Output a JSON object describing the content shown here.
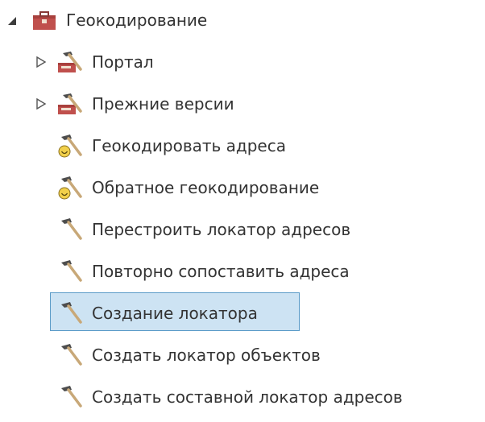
{
  "tree": {
    "root": {
      "label": "Геокодирование",
      "expanded": true,
      "icon": "toolbox-icon"
    },
    "items": [
      {
        "label": "Портал",
        "icon": "toolset-icon",
        "expandable": true
      },
      {
        "label": "Прежние версии",
        "icon": "toolset-icon",
        "expandable": true
      },
      {
        "label": "Геокодировать адреса",
        "icon": "hammer-geocode-icon",
        "expandable": false
      },
      {
        "label": "Обратное геокодирование",
        "icon": "hammer-geocode-icon",
        "expandable": false
      },
      {
        "label": "Перестроить локатор адресов",
        "icon": "hammer-icon",
        "expandable": false
      },
      {
        "label": "Повторно сопоставить адреса",
        "icon": "hammer-icon",
        "expandable": false
      },
      {
        "label": "Создание локатора",
        "icon": "hammer-icon",
        "expandable": false,
        "selected": true
      },
      {
        "label": "Создать локатор объектов",
        "icon": "hammer-icon",
        "expandable": false
      },
      {
        "label": "Создать составной локатор адресов",
        "icon": "hammer-icon",
        "expandable": false
      }
    ]
  },
  "colors": {
    "selection_fill": "#cde3f3",
    "selection_border": "#5b9bc8",
    "toolbox": "#c0504d",
    "hammer_head": "#4d4d4d",
    "hammer_handle": "#c8a878",
    "geocode_badge": "#f2d04a"
  }
}
